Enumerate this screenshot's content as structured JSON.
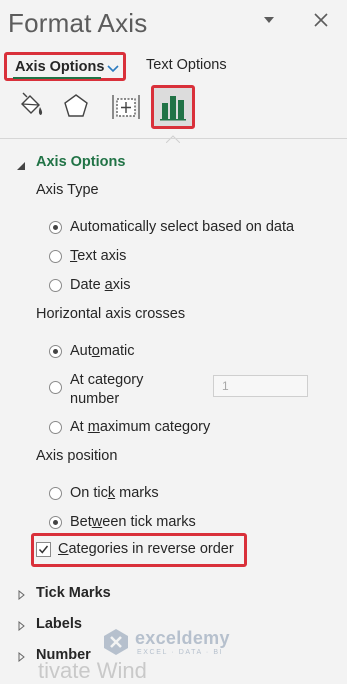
{
  "pane": {
    "title": "Format Axis"
  },
  "tabs": {
    "primary": "Axis Options",
    "secondary": "Text Options"
  },
  "icons": [
    "fill-line-icon",
    "effects-icon",
    "size-properties-icon",
    "axis-options-icon"
  ],
  "section": {
    "title": "Axis Options",
    "axis_type": {
      "label": "Axis Type",
      "options": [
        {
          "pre": "Automatically",
          "u": "",
          "post": " select based on data",
          "selected": true
        },
        {
          "pre": "",
          "u": "T",
          "post": "ext axis",
          "selected": false
        },
        {
          "pre": "Date ",
          "u": "a",
          "post": "xis",
          "selected": false
        }
      ]
    },
    "crosses": {
      "label": "Horizontal axis crosses",
      "automatic": {
        "pre": "Aut",
        "u": "o",
        "post": "matic"
      },
      "at_category": {
        "line1_pre": "At cate",
        "line1_u": "g",
        "line1_post": "ory",
        "line2": "number",
        "value": "1"
      },
      "at_maximum": {
        "pre": "At ",
        "u": "m",
        "post": "aximum category"
      }
    },
    "position": {
      "label": "Axis position",
      "on_tick": {
        "pre": "On tic",
        "u": "k",
        "post": " marks"
      },
      "between": {
        "pre": "Bet",
        "u": "w",
        "post": "een tick marks"
      }
    },
    "reverse": {
      "pre": "",
      "u": "C",
      "post": "ategories in reverse order",
      "checked": true
    }
  },
  "collapsed_sections": [
    "Tick Marks",
    "Labels",
    "Number"
  ],
  "watermark": {
    "name": "exceldemy",
    "tagline": "EXCEL · DATA · BI"
  },
  "ghost_text": "tivate Wind",
  "colors": {
    "accent": "#217346",
    "highlight": "#d9303a",
    "background": "#f3f3f3"
  }
}
